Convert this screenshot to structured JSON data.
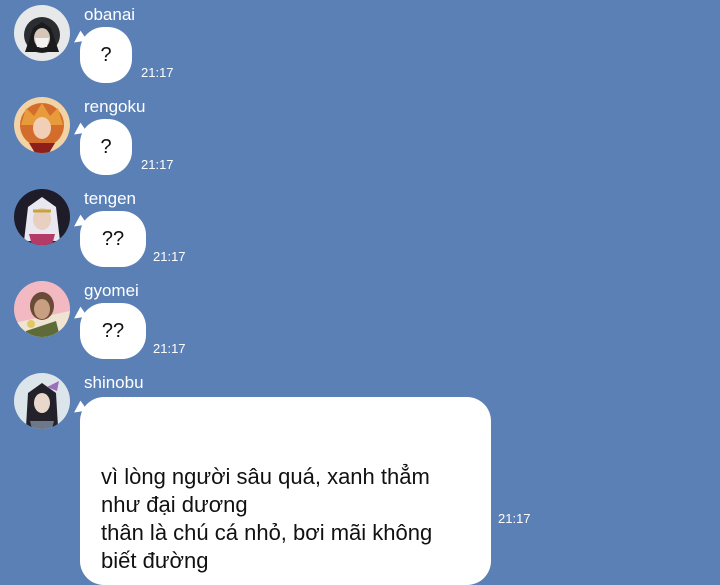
{
  "theme": {
    "background": "#5b80b6",
    "bubble": "#ffffff",
    "text_on_background": "#ffffff"
  },
  "messages": [
    {
      "sender": "obanai",
      "text": "?",
      "time": "21:17",
      "avatar_icon": "anime-avatar-dark-hair-icon"
    },
    {
      "sender": "rengoku",
      "text": "?",
      "time": "21:17",
      "avatar_icon": "anime-avatar-fire-hair-icon"
    },
    {
      "sender": "tengen",
      "text": "??",
      "time": "21:17",
      "avatar_icon": "anime-avatar-white-hair-icon"
    },
    {
      "sender": "gyomei",
      "text": "??",
      "time": "21:17",
      "avatar_icon": "anime-avatar-monk-icon"
    },
    {
      "sender": "shinobu",
      "text": "vì lòng người sâu quá, xanh thẳm\nnhư đại dương\nthân là chú cá nhỏ, bơi mãi không\nbiết đường",
      "time": "21:17",
      "avatar_icon": "anime-avatar-butterfly-icon"
    }
  ]
}
